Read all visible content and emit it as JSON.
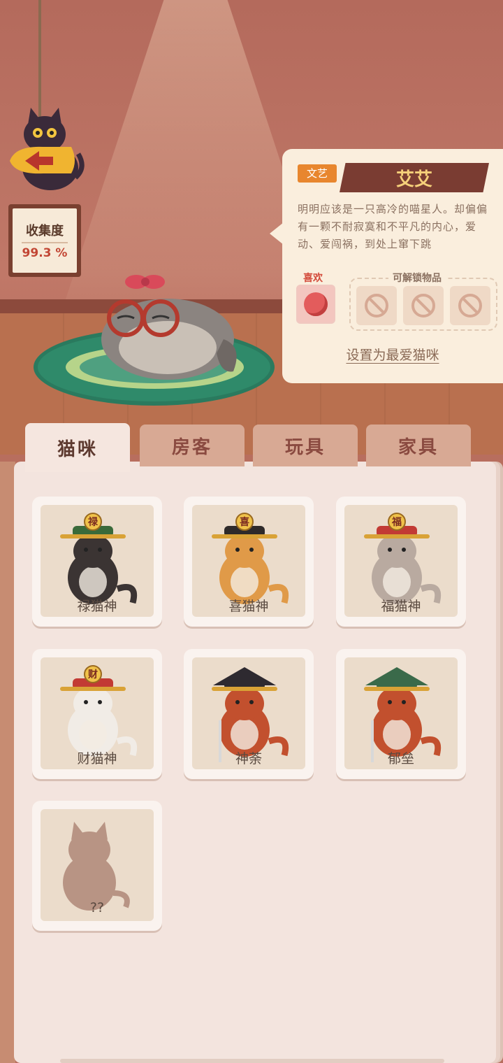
{
  "collection": {
    "title": "收集度",
    "value": "99.3 %"
  },
  "cat_profile": {
    "tag": "文艺",
    "name": "艾艾",
    "description": "明明应该是一只高冷的喵星人。却偏偏有一颗不耐寂寞和不平凡的内心，爱动、爱闯祸，到处上窜下跳",
    "like_label": "喜欢",
    "liked_item_icon": "yarn-ball-icon",
    "unlockable_label": "可解锁物品",
    "unlockable_slots": [
      "locked-icon",
      "locked-icon",
      "locked-icon"
    ],
    "favorite_link": "设置为最爱猫咪"
  },
  "tabs": [
    {
      "label": "猫咪",
      "active": true
    },
    {
      "label": "房客",
      "active": false
    },
    {
      "label": "玩具",
      "active": false
    },
    {
      "label": "家具",
      "active": false
    }
  ],
  "cats": [
    {
      "name": "禄猫神",
      "badge": "禄",
      "body": "#3b3433",
      "hat": "#3a6a3a"
    },
    {
      "name": "喜猫神",
      "badge": "喜",
      "body": "#e09a48",
      "hat": "#2e2a2a"
    },
    {
      "name": "福猫神",
      "badge": "福",
      "body": "#b9aaa0",
      "hat": "#c23a34"
    },
    {
      "name": "财猫神",
      "badge": "财",
      "body": "#f1ece6",
      "hat": "#c23a34"
    },
    {
      "name": "神荼",
      "badge": "",
      "body": "#c2502e",
      "hat": "#2e2a30"
    },
    {
      "name": "郁垒",
      "badge": "",
      "body": "#c2502e",
      "hat": "#3a6a4a"
    },
    {
      "name": "??",
      "badge": "",
      "body": "#b89484",
      "hat": "",
      "locked": true
    }
  ],
  "colors": {
    "accent_orange": "#e8862e",
    "ribbon": "#7a3c32",
    "name_gold": "#f6d07a"
  }
}
